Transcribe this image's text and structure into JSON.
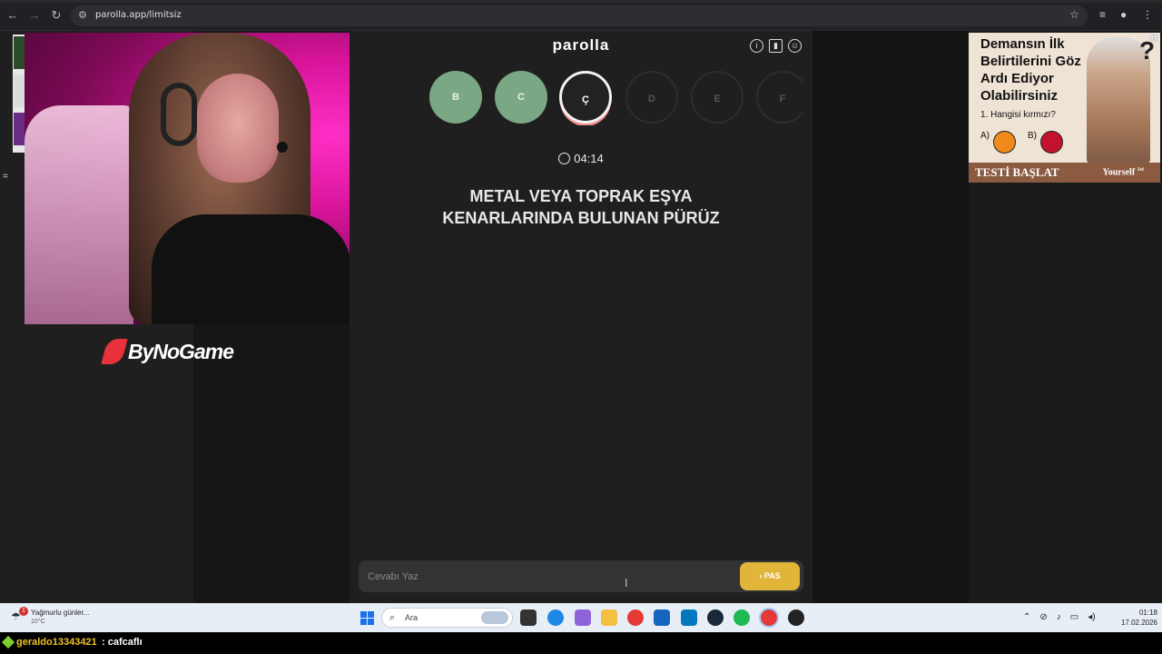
{
  "browser": {
    "url": "parolla.app/limitsiz",
    "back_icon": "arrow-left-icon",
    "forward_icon": "arrow-right-icon",
    "reload_icon": "reload-icon",
    "bookmark_icon": "star-icon"
  },
  "stream": {
    "sponsor_logo_text": "ByNoGame"
  },
  "app": {
    "title": "parolla",
    "icons": [
      "info-icon",
      "stats-icon",
      "profile-icon"
    ],
    "letters": [
      {
        "char": "B",
        "state": "done"
      },
      {
        "char": "C",
        "state": "done"
      },
      {
        "char": "Ç",
        "state": "active"
      },
      {
        "char": "D",
        "state": "pending"
      },
      {
        "char": "E",
        "state": "pending"
      },
      {
        "char": "F",
        "state": "pending"
      }
    ],
    "timer": "04:14",
    "question": "METAL VEYA TOPRAK EŞYA KENARLARINDA BULUNAN PÜRÜZ",
    "answer_placeholder": "Cevabı Yaz",
    "answer_value": "",
    "pass_button": "PAS",
    "pass_icon": "chevron-right-icon",
    "colors": {
      "done": "#7aa784",
      "pass": "#e0b53a"
    }
  },
  "ad": {
    "headline": "Demansın İlk Belirtilerini Göz Ardı Ediyor Olabilirsiniz",
    "question": "1. Hangisi kırmızı?",
    "option_a": "A)",
    "option_b": "B)",
    "cta": "TESTİ BAŞLAT",
    "brand": "Yourself",
    "brand_sup": "1st",
    "colors": {
      "a": "#f08a1c",
      "b": "#c4122e"
    }
  },
  "taskbar": {
    "weather_text": "Yağmurlu günler...",
    "weather_temp": "10°C",
    "weather_badge": "1",
    "search_label": "Ara",
    "time": "01:18",
    "date": "17.02.2026"
  },
  "chat": {
    "username": "geraldo13343421",
    "separator": ":",
    "message": "cafcaflı"
  }
}
